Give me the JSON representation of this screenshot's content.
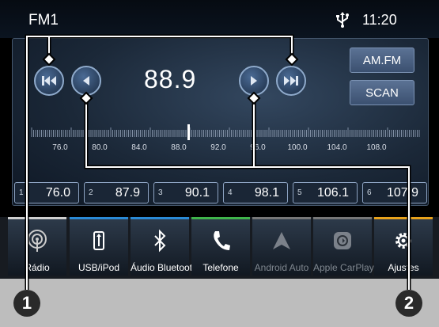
{
  "status_bar": {
    "band": "FM1",
    "time": "11:20",
    "usb_icon": "usb-trident-icon"
  },
  "tuner": {
    "frequency": "88.9",
    "buttons": {
      "am_fm": "AM.FM",
      "scan": "SCAN"
    },
    "scale_labels": [
      "76.0",
      "80.0",
      "84.0",
      "88.0",
      "92.0",
      "96.0",
      "100.0",
      "104.0",
      "108.0"
    ]
  },
  "presets": [
    {
      "num": "1",
      "freq": "76.0"
    },
    {
      "num": "2",
      "freq": "87.9"
    },
    {
      "num": "3",
      "freq": "90.1"
    },
    {
      "num": "4",
      "freq": "98.1"
    },
    {
      "num": "5",
      "freq": "106.1"
    },
    {
      "num": "6",
      "freq": "107.9"
    }
  ],
  "dock": [
    {
      "label": "Rádio",
      "icon": "radio-icon",
      "accent": "#cfcfcf"
    },
    {
      "label": "USB/iPod",
      "icon": "usb-icon",
      "accent": "#2a8ad6"
    },
    {
      "label": "Áudio Bluetooth",
      "icon": "bluetooth-icon",
      "accent": "#2a8ad6"
    },
    {
      "label": "Telefone",
      "icon": "phone-icon",
      "accent": "#3fb54a"
    },
    {
      "label": "Android Auto",
      "icon": "android-auto-icon",
      "accent": "#777777"
    },
    {
      "label": "Apple CarPlay",
      "icon": "carplay-icon",
      "accent": "#777777"
    },
    {
      "label": "Ajustes",
      "icon": "gear-icon",
      "accent": "#e8a21b"
    }
  ],
  "callouts": [
    "1",
    "2"
  ]
}
